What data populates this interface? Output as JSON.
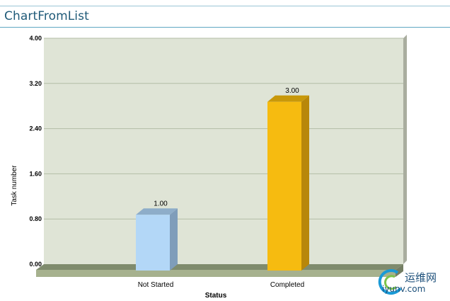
{
  "page": {
    "title": "ChartFromList"
  },
  "chart_data": {
    "type": "bar",
    "categories": [
      "Not Started",
      "Completed"
    ],
    "values": [
      1.0,
      3.0
    ],
    "value_labels": [
      "1.00",
      "3.00"
    ],
    "xlabel": "Status",
    "ylabel": "Task number",
    "ylim": [
      0,
      4
    ],
    "yticks": [
      "0.00",
      "0.80",
      "1.60",
      "2.40",
      "3.20",
      "4.00"
    ],
    "grid": true,
    "legend": "none",
    "colors": {
      "bars": [
        "#b3d7f7",
        "#f6bb10"
      ],
      "bar_tops": [
        "#8eadc9",
        "#c8980a"
      ],
      "bar_sides": [
        "#7f9dba",
        "#b8870a"
      ],
      "plot_background": "#dfe4d6",
      "grid": "#b3bda6",
      "floor": "#a6b18e",
      "floor_top": "#7f8b6d"
    }
  },
  "watermark": {
    "line1": "运维网",
    "line2": "iyunv.com"
  }
}
